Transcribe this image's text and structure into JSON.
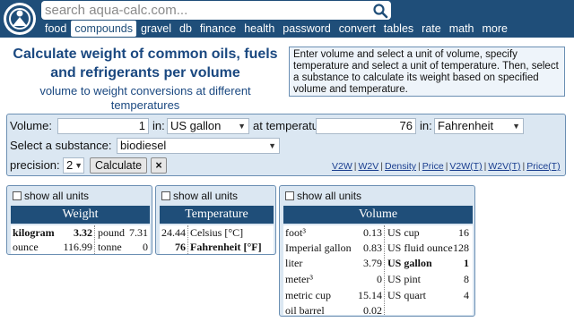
{
  "header": {
    "search_placeholder": "search aqua-calc.com...",
    "nav": [
      "food",
      "compounds",
      "gravel",
      "db",
      "finance",
      "health",
      "password",
      "convert",
      "tables",
      "rate",
      "math",
      "more"
    ],
    "active_nav": "compounds"
  },
  "title": "Calculate weight of common oils, fuels and refrigerants per volume",
  "subtitle": "volume to weight conversions at different temperatures",
  "intro": "Enter volume and select a unit of volume, specify temperature and select a unit of temperature. Then, select a substance to calculate its weight based on specified volume and temperature.",
  "form": {
    "volume_label": "Volume:",
    "volume_value": "1",
    "in_label": "in:",
    "volume_unit": "US gallon",
    "temp_label": "at temperature:",
    "temp_value": "76",
    "in_label2": "in:",
    "temp_unit": "Fahrenheit",
    "substance_label": "Select a substance:",
    "substance": "biodiesel",
    "precision_label": "precision:",
    "precision": "2",
    "calculate": "Calculate",
    "clear": "×",
    "links": [
      "V2W",
      "W2V",
      "Density",
      "Price",
      "V2W(T)",
      "W2V(T)",
      "Price(T)"
    ]
  },
  "show_all": "show all units",
  "weight": {
    "heading": "Weight",
    "rows": [
      {
        "unit": "kilogram",
        "value": "3.32",
        "unit2": "pound",
        "value2": "7.31"
      },
      {
        "unit": "ounce",
        "value": "116.99",
        "unit2": "tonne",
        "value2": "0"
      }
    ]
  },
  "temperature": {
    "heading": "Temperature",
    "rows": [
      {
        "value": "24.44",
        "unit": "Celsius [°C]"
      },
      {
        "value": "76",
        "unit": "Fahrenheit [°F]"
      }
    ]
  },
  "volume": {
    "heading": "Volume",
    "rows": [
      {
        "unit": "foot³",
        "value": "0.13",
        "unit2": "US cup",
        "value2": "16"
      },
      {
        "unit": "Imperial gallon",
        "value": "0.83",
        "unit2": "US fluid ounce",
        "value2": "128"
      },
      {
        "unit": "liter",
        "value": "3.79",
        "unit2": "US gallon",
        "value2": "1"
      },
      {
        "unit": "meter³",
        "value": "0",
        "unit2": "US pint",
        "value2": "8"
      },
      {
        "unit": "metric cup",
        "value": "15.14",
        "unit2": "US quart",
        "value2": "4"
      },
      {
        "unit": "oil barrel",
        "value": "0.02",
        "unit2": "",
        "value2": ""
      }
    ]
  },
  "colors": {
    "brand": "#1f4e79",
    "panel": "#dbe7f2",
    "title": "#1a4880"
  }
}
